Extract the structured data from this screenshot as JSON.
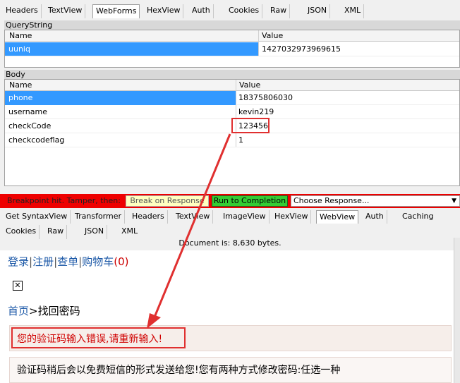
{
  "top_tabs": [
    "Headers",
    "TextView",
    "WebForms",
    "HexView",
    "Auth",
    "Cookies",
    "Raw",
    "JSON",
    "XML"
  ],
  "querystring": {
    "title": "QueryString",
    "col_name": "Name",
    "col_value": "Value",
    "rows": [
      {
        "name": "uuniq",
        "value": "1427032973969615"
      }
    ]
  },
  "body": {
    "title": "Body",
    "col_name": "Name",
    "col_value": "Value",
    "rows": [
      {
        "name": "phone",
        "value": "18375806030"
      },
      {
        "name": "username",
        "value": "kevin219"
      },
      {
        "name": "checkCode",
        "value": "123456"
      },
      {
        "name": "checkcodeflag",
        "value": "1"
      }
    ]
  },
  "breakpoint": {
    "text": "Breakpoint hit. Tamper, then:",
    "break_label": "Break on Response",
    "run_label": "Run to Completion",
    "choose_label": "Choose Response..."
  },
  "resp_tabs_1": [
    "Get SyntaxView",
    "Transformer",
    "Headers",
    "TextView",
    "ImageView",
    "HexView",
    "WebView",
    "Auth",
    "Caching"
  ],
  "resp_tabs_2": [
    "Cookies",
    "Raw",
    "JSON",
    "XML"
  ],
  "doc_info": "Document is: 8,630 bytes.",
  "web": {
    "nav_login": "登录",
    "nav_register": "注册",
    "nav_orders": "查单",
    "nav_cart": "购物车",
    "nav_cart_count": "(0)",
    "nav_sep": "|",
    "broken_image": "✕",
    "crumb_home": "首页",
    "crumb_sep": ">",
    "crumb_current": "找回密码",
    "error_msg": "您的验证码输入错误,请重新输入!",
    "info_msg": "验证码稍后会以免费短信的形式发送给您!您有两种方式修改密码:任选一种"
  },
  "colors": {
    "breakpoint_bar": "#ee0000",
    "run_button": "#33cc33",
    "selected_row": "#3399ff",
    "link": "#1e5aa8",
    "annotation": "#e03030"
  }
}
